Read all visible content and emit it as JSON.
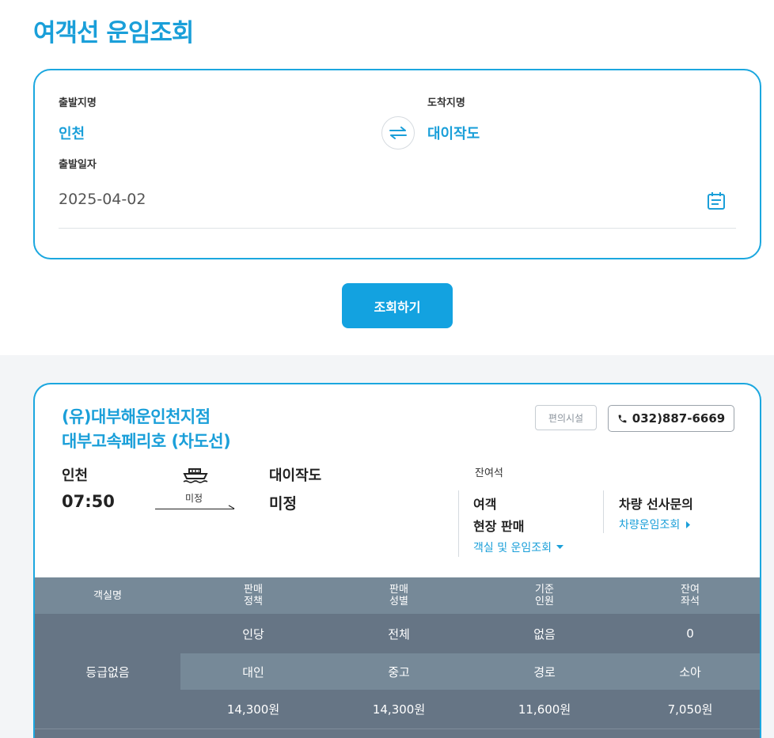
{
  "page": {
    "title": "여객선 운임조회"
  },
  "search": {
    "departure_label": "출발지명",
    "departure_value": "인천",
    "arrival_label": "도착지명",
    "arrival_value": "대이작도",
    "date_label": "출발일자",
    "date_value": "2025-04-02",
    "search_button": "조회하기",
    "swap_icon": "swap-arrows-icon",
    "calendar_icon": "calendar-icon"
  },
  "result": {
    "company": "(유)대부해운인천지점",
    "vessel": "대부고속페리호 (차도선)",
    "facility_button": "편의시설",
    "phone": "032)887-6669",
    "departure_place": "인천",
    "departure_time": "07:50",
    "route_status": "미정",
    "arrival_place": "대이작도",
    "arrival_time": "미정",
    "remaining_title": "잔여석",
    "passenger_line1": "여객",
    "passenger_line2": "현장 판매",
    "passenger_link": "객실 및 운임조회",
    "vehicle_title": "차량 선사문의",
    "vehicle_link": "차량운임조회",
    "colors": {
      "accent": "#1a9fd9",
      "table_header": "#768998",
      "table_body": "#667585"
    }
  },
  "fare_table": {
    "headers": [
      "객실명",
      "판매\n정책",
      "판매\n성별",
      "기준\n인원",
      "잔여\n좌석"
    ],
    "grade": "등급없음",
    "row1": [
      "인당",
      "전체",
      "없음",
      "0"
    ],
    "row2": [
      "대인",
      "중고",
      "경로",
      "소아"
    ],
    "row3": [
      "14,300원",
      "14,300원",
      "11,600원",
      "7,050원"
    ]
  }
}
